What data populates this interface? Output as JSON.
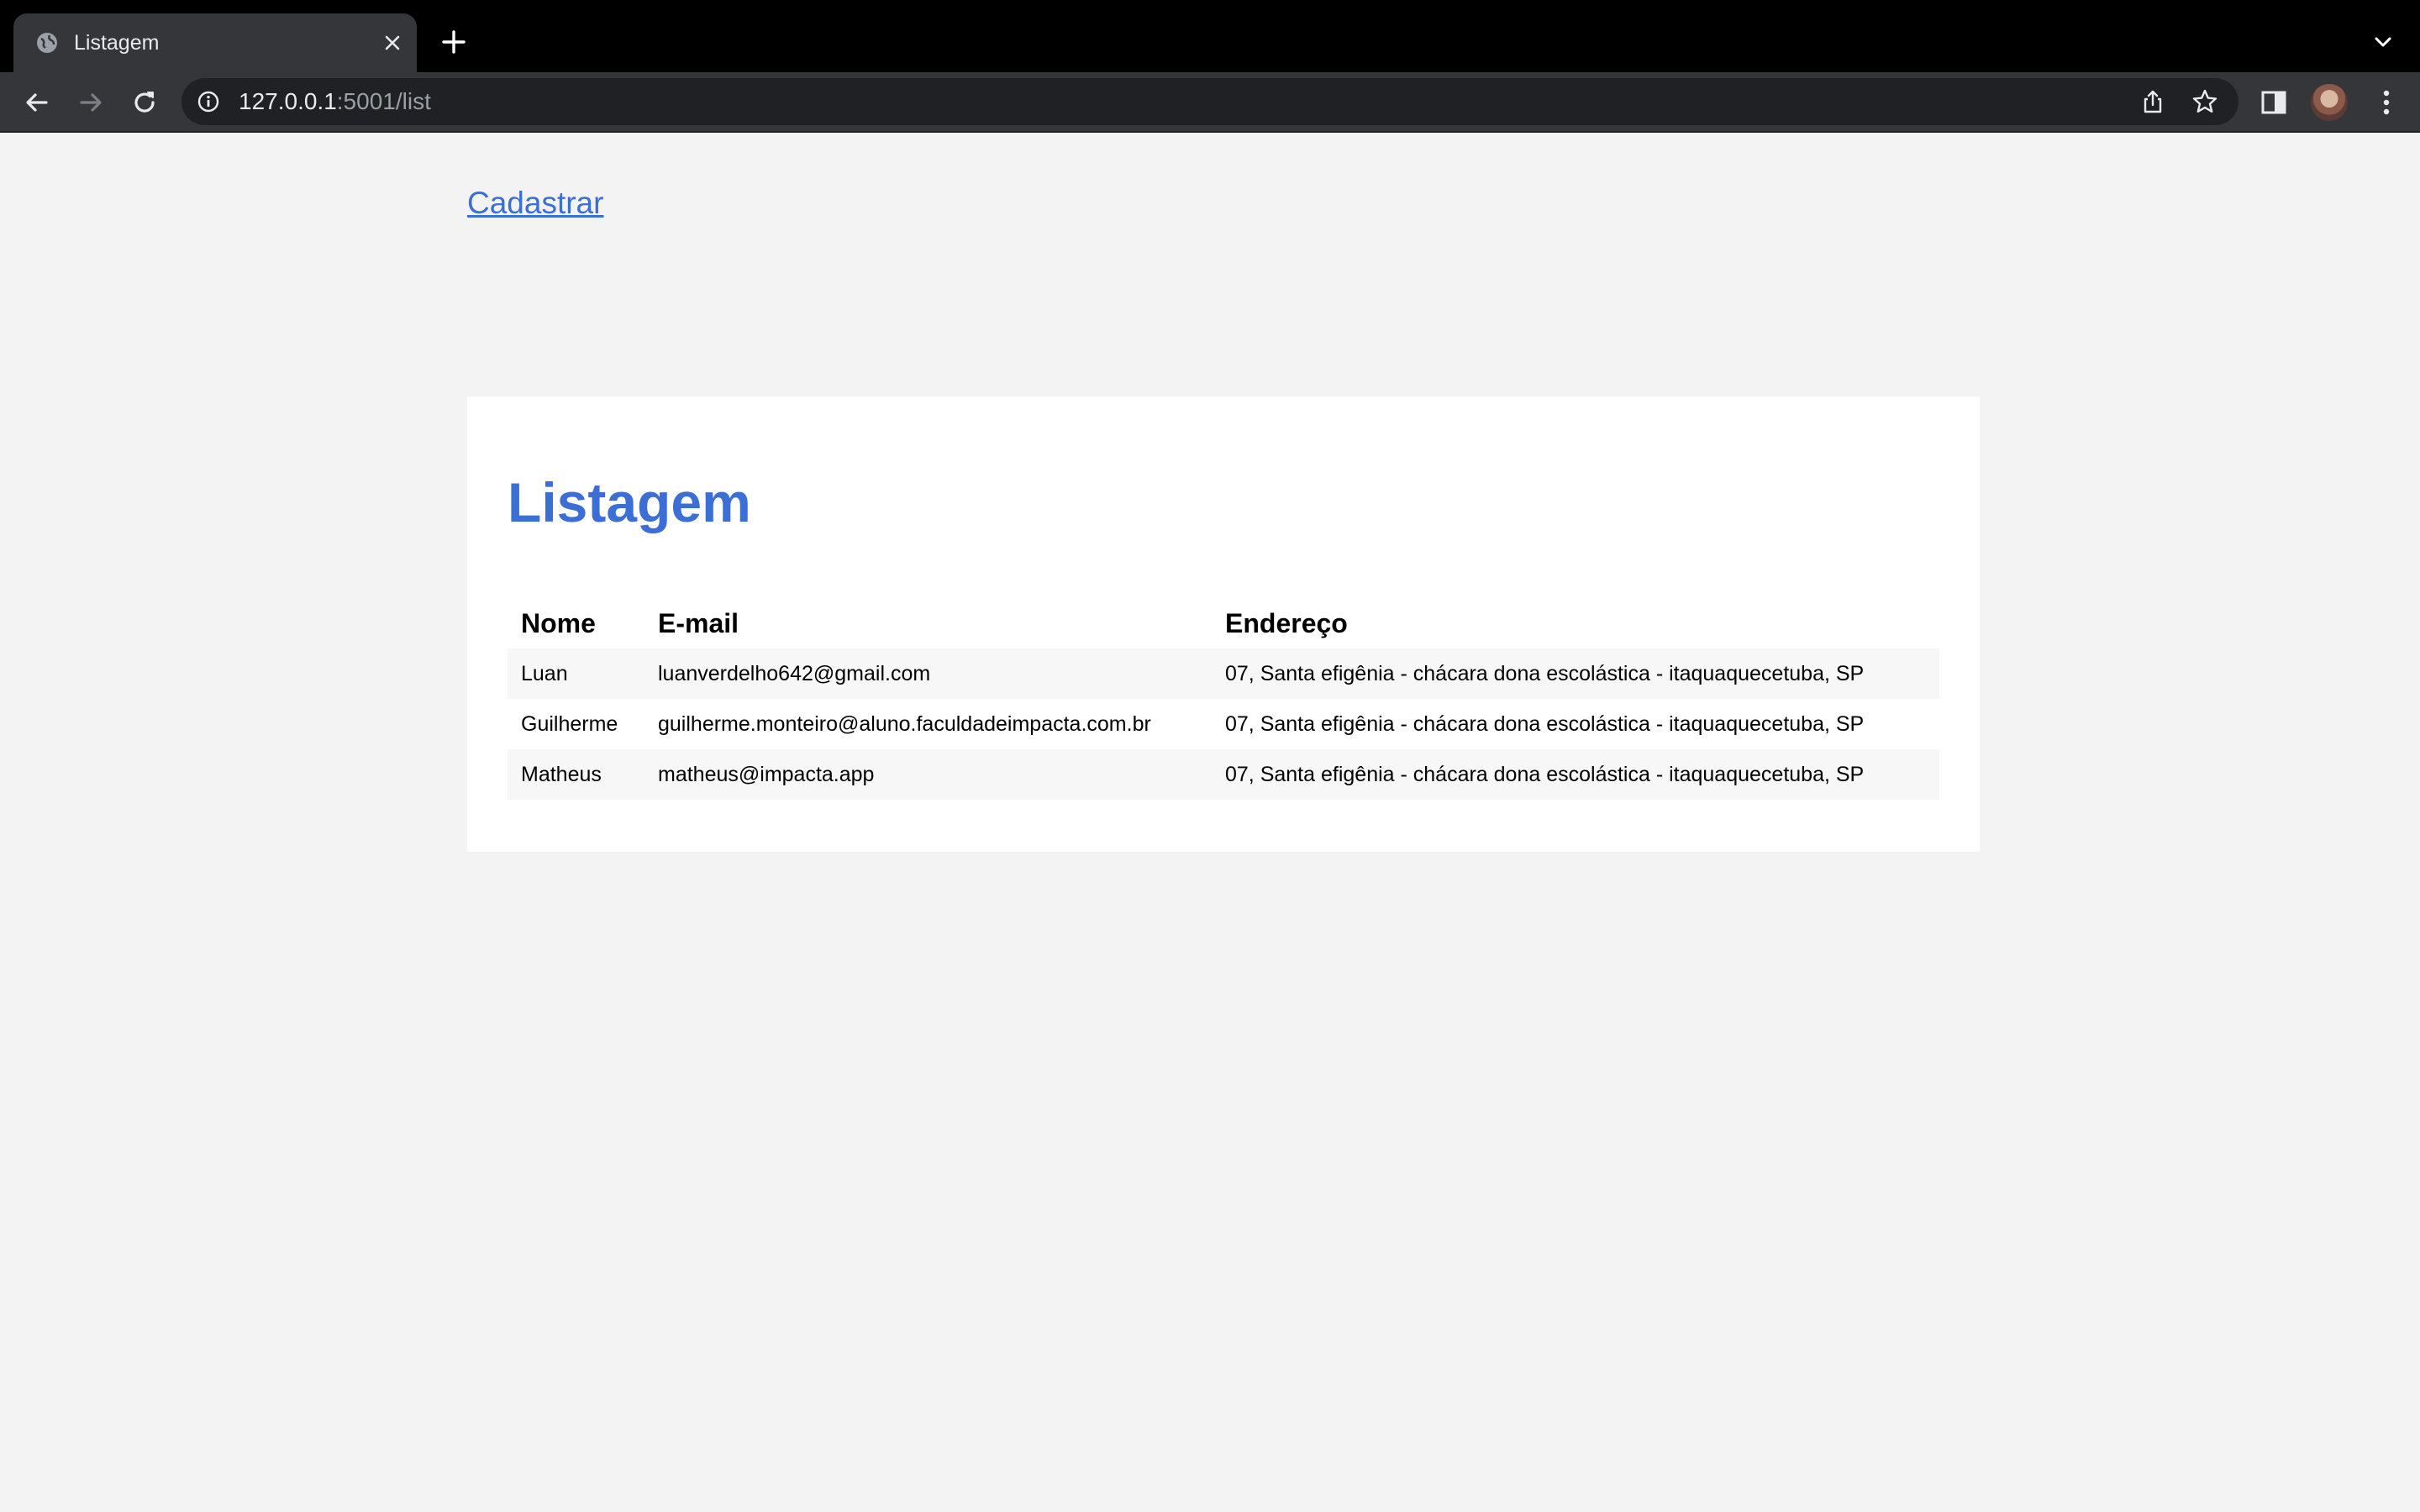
{
  "browser": {
    "tab_title": "Listagem",
    "url_host": "127.0.0.1",
    "url_path": ":5001/list"
  },
  "page": {
    "register_link": "Cadastrar",
    "heading": "Listagem",
    "table": {
      "headers": {
        "name": "Nome",
        "email": "E-mail",
        "address": "Endereço"
      },
      "rows": [
        {
          "name": "Luan",
          "email": "luanverdelho642@gmail.com",
          "address": "07, Santa efigênia - chácara dona escolástica - itaquaquecetuba, SP"
        },
        {
          "name": "Guilherme",
          "email": "guilherme.monteiro@aluno.faculdadeimpacta.com.br",
          "address": "07, Santa efigênia - chácara dona escolástica - itaquaquecetuba, SP"
        },
        {
          "name": "Matheus",
          "email": "matheus@impacta.app",
          "address": "07, Santa efigênia - chácara dona escolástica - itaquaquecetuba, SP"
        }
      ]
    }
  },
  "colors": {
    "accent": "#3b6fd6",
    "page_background": "#f3f3f3",
    "card_background": "#ffffff",
    "striped_row": "#f7f7f7"
  }
}
